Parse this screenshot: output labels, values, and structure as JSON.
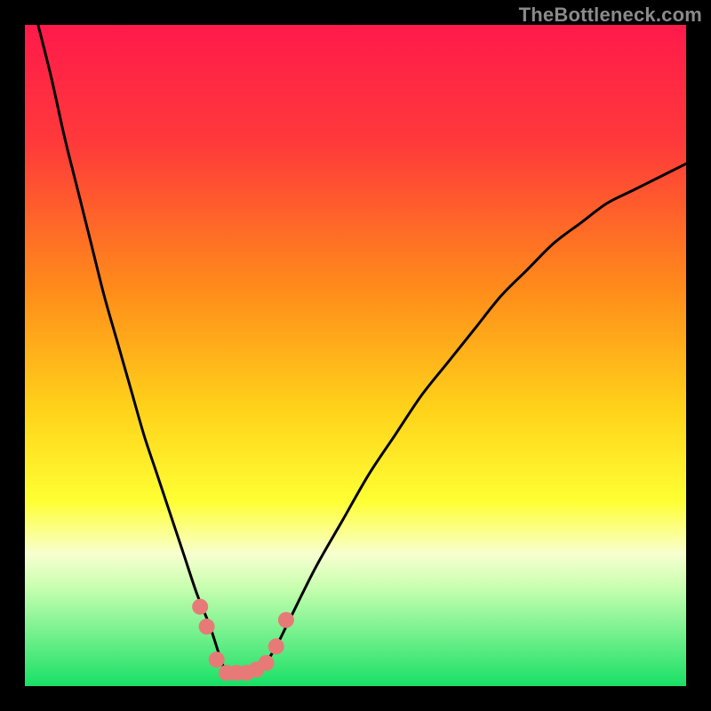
{
  "watermark": "TheBottleneck.com",
  "chart_data": {
    "type": "line",
    "title": "",
    "xlabel": "",
    "ylabel": "",
    "xlim": [
      0,
      100
    ],
    "ylim": [
      0,
      100
    ],
    "gradient_stops": [
      {
        "offset": 0,
        "color": "#ff1a4b"
      },
      {
        "offset": 18,
        "color": "#ff3a3a"
      },
      {
        "offset": 40,
        "color": "#ff8c1a"
      },
      {
        "offset": 58,
        "color": "#ffd21a"
      },
      {
        "offset": 72,
        "color": "#ffff33"
      },
      {
        "offset": 80,
        "color": "#f8ffd0"
      },
      {
        "offset": 85,
        "color": "#c8ffb0"
      },
      {
        "offset": 100,
        "color": "#18e066"
      }
    ],
    "series": [
      {
        "name": "bottleneck-curve",
        "x": [
          2,
          4,
          6,
          8,
          10,
          12,
          14,
          16,
          18,
          20,
          22,
          24,
          26,
          28,
          30,
          31,
          32,
          34,
          36,
          38,
          40,
          44,
          48,
          52,
          56,
          60,
          64,
          68,
          72,
          76,
          80,
          84,
          88,
          92,
          96,
          100
        ],
        "y": [
          100,
          92,
          83,
          75,
          67,
          59,
          52,
          45,
          38,
          32,
          26,
          20,
          14,
          9,
          3,
          2,
          2,
          2,
          3,
          6,
          10,
          18,
          25,
          32,
          38,
          44,
          49,
          54,
          59,
          63,
          67,
          70,
          73,
          75,
          77,
          79
        ]
      }
    ],
    "markers": {
      "name": "valley-points",
      "color": "#e77a77",
      "points": [
        {
          "x": 26.5,
          "y": 12
        },
        {
          "x": 27.5,
          "y": 9
        },
        {
          "x": 29,
          "y": 4
        },
        {
          "x": 30.5,
          "y": 2
        },
        {
          "x": 32,
          "y": 2
        },
        {
          "x": 33.5,
          "y": 2
        },
        {
          "x": 35,
          "y": 2.5
        },
        {
          "x": 36.5,
          "y": 3.5
        },
        {
          "x": 38,
          "y": 6
        },
        {
          "x": 39.5,
          "y": 10
        }
      ]
    }
  }
}
